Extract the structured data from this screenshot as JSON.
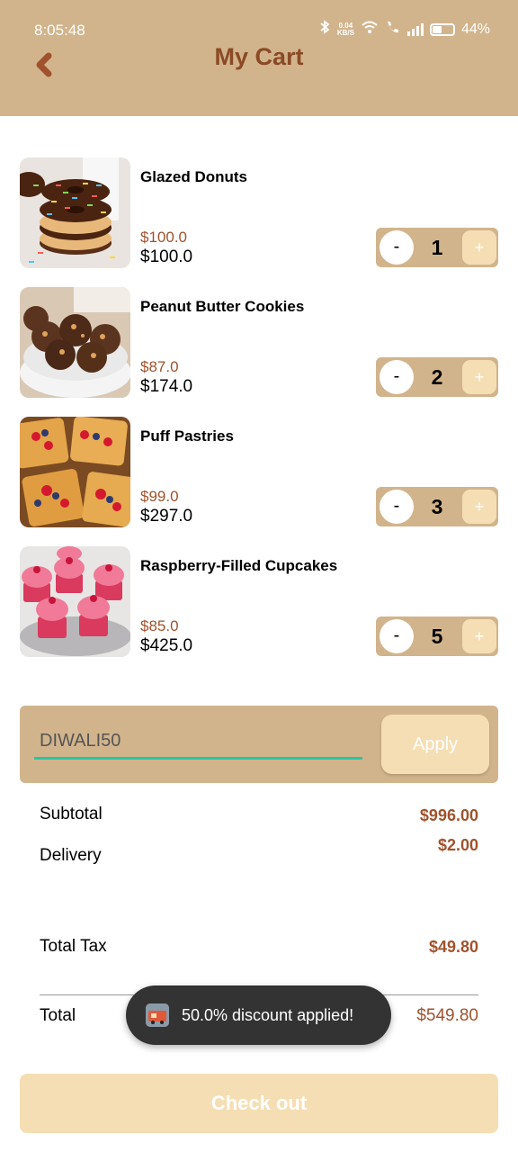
{
  "status_bar": {
    "time": "8:05:48",
    "net_speed_value": "0.04",
    "net_speed_unit": "KB/S",
    "battery": "44%"
  },
  "header": {
    "title": "My Cart",
    "back_icon": "chevron-left-icon"
  },
  "cart_items": [
    {
      "name": "Glazed Donuts",
      "unit_price": "$100.0",
      "line_total": "$100.0",
      "minus": "-",
      "quantity": "1",
      "plus": "+"
    },
    {
      "name": "Peanut Butter Cookies",
      "unit_price": "$87.0",
      "line_total": "$174.0",
      "minus": "-",
      "quantity": "2",
      "plus": "+"
    },
    {
      "name": "Puff Pastries",
      "unit_price": "$99.0",
      "line_total": "$297.0",
      "minus": "-",
      "quantity": "3",
      "plus": "+"
    },
    {
      "name": "Raspberry-Filled Cupcakes",
      "unit_price": "$85.0",
      "line_total": "$425.0",
      "minus": "-",
      "quantity": "5",
      "plus": "+"
    }
  ],
  "promo": {
    "code_value": "DIWALI50",
    "apply_label": "Apply"
  },
  "summary": {
    "subtotal_label": "Subtotal",
    "subtotal_value": "$996.00",
    "delivery_label": "Delivery",
    "delivery_value": "$2.00",
    "tax_label": "Total Tax",
    "tax_value": "$49.80",
    "total_label": "Total",
    "total_value": "$549.80"
  },
  "toast": {
    "message": "50.0% discount applied!"
  },
  "checkout": {
    "label": "Check out"
  },
  "colors": {
    "appbar": "#d2b48c",
    "title": "#8b4a26",
    "price": "#a0522d",
    "accent_light": "#f5deb3",
    "input_underline": "#26c6a6"
  }
}
